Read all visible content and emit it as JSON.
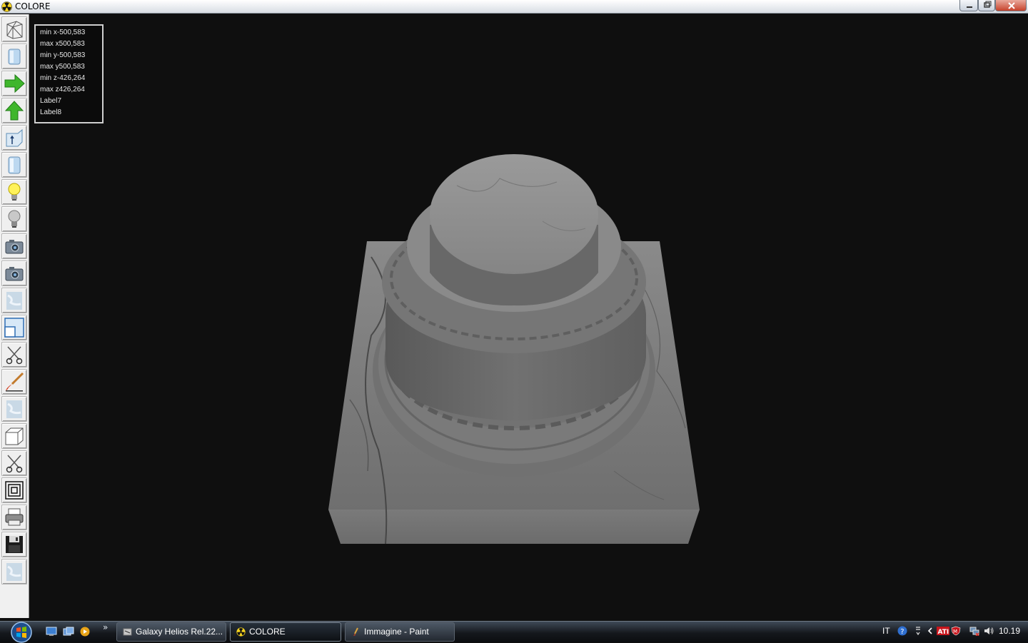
{
  "window": {
    "title": "COLORE",
    "controls": [
      "minimize",
      "maximize",
      "close"
    ]
  },
  "toolbar": {
    "tools": [
      {
        "name": "wireframe-tool",
        "icon": "wireframe-icon"
      },
      {
        "name": "solid-view-tool",
        "icon": "cylinder-icon"
      },
      {
        "name": "move-right-tool",
        "icon": "green-right-arrow-icon"
      },
      {
        "name": "move-up-tool",
        "icon": "green-up-arrow-icon"
      },
      {
        "name": "axis-tool",
        "icon": "cube-axis-icon"
      },
      {
        "name": "light-cylinder-tool",
        "icon": "cylinder-icon"
      },
      {
        "name": "light-on-tool",
        "icon": "yellow-bulb-icon"
      },
      {
        "name": "light-off-tool",
        "icon": "grey-bulb-icon"
      },
      {
        "name": "camera-tool",
        "icon": "camera-icon"
      },
      {
        "name": "camera-2-tool",
        "icon": "camera-icon"
      },
      {
        "name": "texture-tool",
        "icon": "texture-icon"
      },
      {
        "name": "window-tool",
        "icon": "window-icon"
      },
      {
        "name": "cut-tool",
        "icon": "scissors-icon"
      },
      {
        "name": "paint-tool",
        "icon": "brush-icon"
      },
      {
        "name": "texture-2-tool",
        "icon": "texture-icon"
      },
      {
        "name": "box-tool",
        "icon": "box-icon"
      },
      {
        "name": "cut-2-tool",
        "icon": "scissors-icon"
      },
      {
        "name": "frames-tool",
        "icon": "nested-squares-icon"
      },
      {
        "name": "print-tool",
        "icon": "printer-icon"
      },
      {
        "name": "save-tool",
        "icon": "floppy-icon"
      },
      {
        "name": "texture-3-tool",
        "icon": "texture-icon"
      }
    ]
  },
  "info": {
    "lines": [
      "min x-500,583",
      "max x500,583",
      "min y-500,583",
      "max y500,583",
      "min z-426,264",
      "max z426,264",
      "Label7",
      "Label8"
    ]
  },
  "taskbar": {
    "tasks": [
      {
        "label": "Galaxy Helios  Rel.22...",
        "icon": "app-icon"
      },
      {
        "label": "COLORE",
        "icon": "radiation-icon"
      },
      {
        "label": "Immagine - Paint",
        "icon": "paint-icon"
      }
    ],
    "lang": "IT",
    "clock": "10.19",
    "chevron": "»"
  },
  "colors": {
    "viewport_bg": "#0f0f0f",
    "marble": "#8e8e8e"
  }
}
